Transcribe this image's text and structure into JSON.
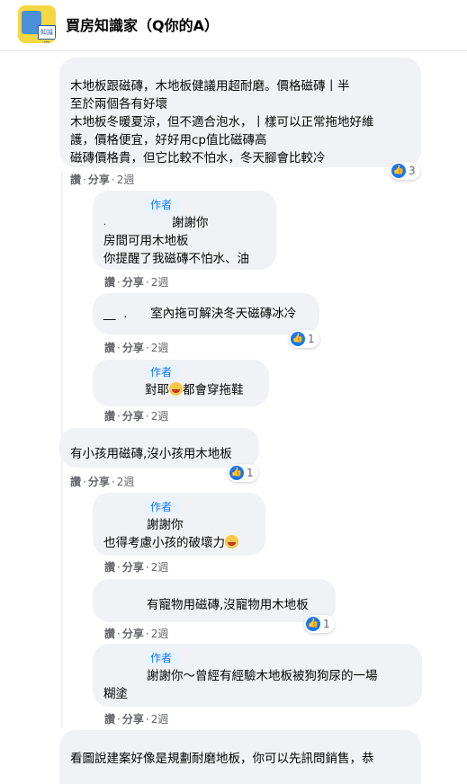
{
  "header": {
    "group_name": "買房知識家（",
    "group_name_q": "Q你的A",
    "group_name_end": "）",
    "logo_tag": "知識家"
  },
  "comments": [
    {
      "text_lines": [
        "木地板跟磁磚，木地板健議用超耐磨。價格磁磚丨半",
        "至於兩個各有好壞",
        "木地板冬暖夏涼，但不適合泡水，丨樣可以正常拖地好維",
        "護，價格便宜，好好用cp值比磁磚高",
        "磁磚價格貴，但它比較不怕水，冬天腳會比較冷"
      ],
      "reaction_count": "3",
      "meta": {
        "like": "讚",
        "reply": "分享",
        "time": "2週"
      }
    },
    {
      "author_badge": "作者",
      "text_lines": [
        "謝謝你",
        "房間可用木地板",
        "你提醒了我磁磚不怕水、油"
      ],
      "meta": {
        "like": "讚",
        "reply": "分享",
        "time": "2週"
      }
    },
    {
      "text_lines": [
        "室內拖可解決冬天磁磚冰冷"
      ],
      "reaction_count": "1",
      "meta": {
        "like": "讚",
        "reply": "分享",
        "time": "2週"
      }
    },
    {
      "author_badge": "作者",
      "text_before": "對耶",
      "text_after": "都會穿拖鞋",
      "meta": {
        "like": "讚",
        "reply": "分享",
        "time": "2週"
      }
    },
    {
      "text_lines": [
        "有小孩用磁磚,沒小孩用木地板"
      ],
      "reaction_count": "1",
      "meta": {
        "like": "讚",
        "reply": "分享",
        "time": "2週"
      }
    },
    {
      "author_badge": "作者",
      "text_lines": [
        "謝謝你",
        "也得考慮小孩的破壞力"
      ],
      "meta": {
        "like": "讚",
        "reply": "分享",
        "time": "2週"
      }
    },
    {
      "text_lines": [
        "有寵物用磁磚,沒寵物用木地板"
      ],
      "reaction_count": "1",
      "meta": {
        "like": "讚",
        "reply": "分享",
        "time": "2週"
      }
    },
    {
      "author_badge": "作者",
      "text_lines": [
        "謝謝你～曾經有經驗木地板被狗狗尿的一場",
        "糊塗"
      ],
      "meta": {
        "like": "讚",
        "reply": "分享",
        "time": "2週"
      }
    },
    {
      "text_lines": [
        "看圖說建案好像是規劃耐磨地板，你可以先訊問銷售，恭"
      ]
    }
  ],
  "colors": {
    "accent": "#1877f2",
    "bubble": "#f0f2f5",
    "meta": "#65676b"
  }
}
